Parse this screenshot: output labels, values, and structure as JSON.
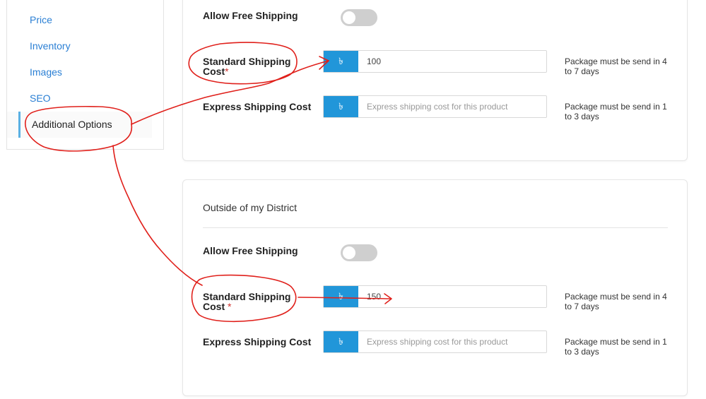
{
  "sidebar": {
    "items": [
      {
        "label": "Price"
      },
      {
        "label": "Inventory"
      },
      {
        "label": "Images"
      },
      {
        "label": "SEO"
      },
      {
        "label": "Additional Options"
      }
    ]
  },
  "currency_symbol": "৳",
  "inside_district": {
    "allow_free_shipping_label": "Allow Free Shipping",
    "allow_free_shipping_enabled": false,
    "standard": {
      "label_line1": "Standard Shipping",
      "label_line2": "Cost",
      "required_mark": "*",
      "value": "100",
      "hint": "Package must be send in 4 to 7 days"
    },
    "express": {
      "label": "Express Shipping Cost",
      "placeholder": "Express shipping cost for this product",
      "hint": "Package must be send in 1 to 3 days"
    }
  },
  "outside_district": {
    "title": "Outside of my District",
    "allow_free_shipping_label": "Allow Free Shipping",
    "allow_free_shipping_enabled": false,
    "standard": {
      "label_line1": "Standard Shipping",
      "label_line2": "Cost",
      "required_mark": "*",
      "value": "150",
      "hint": "Package must be send in 4 to 7 days"
    },
    "express": {
      "label": "Express Shipping Cost",
      "placeholder": "Express shipping cost for this product",
      "hint": "Package must be send in 1 to 3 days"
    }
  },
  "colors": {
    "accent": "#2196d9",
    "link": "#2a7fd4",
    "annotation": "#e0201b",
    "required": "#d0312d"
  }
}
